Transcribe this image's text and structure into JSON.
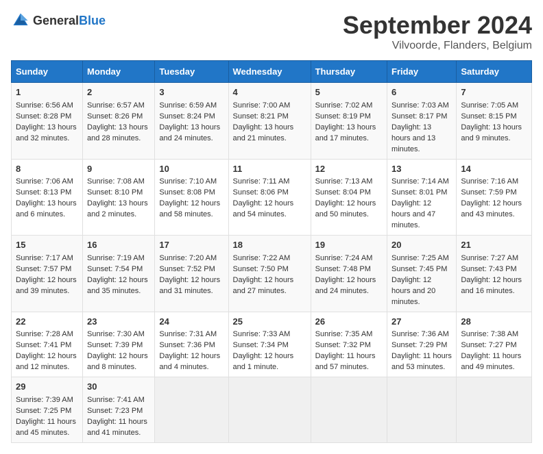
{
  "header": {
    "logo_general": "General",
    "logo_blue": "Blue",
    "title": "September 2024",
    "subtitle": "Vilvoorde, Flanders, Belgium"
  },
  "columns": [
    "Sunday",
    "Monday",
    "Tuesday",
    "Wednesday",
    "Thursday",
    "Friday",
    "Saturday"
  ],
  "weeks": [
    {
      "days": [
        {
          "num": "1",
          "sunrise": "Sunrise: 6:56 AM",
          "sunset": "Sunset: 8:28 PM",
          "daylight": "Daylight: 13 hours and 32 minutes."
        },
        {
          "num": "2",
          "sunrise": "Sunrise: 6:57 AM",
          "sunset": "Sunset: 8:26 PM",
          "daylight": "Daylight: 13 hours and 28 minutes."
        },
        {
          "num": "3",
          "sunrise": "Sunrise: 6:59 AM",
          "sunset": "Sunset: 8:24 PM",
          "daylight": "Daylight: 13 hours and 24 minutes."
        },
        {
          "num": "4",
          "sunrise": "Sunrise: 7:00 AM",
          "sunset": "Sunset: 8:21 PM",
          "daylight": "Daylight: 13 hours and 21 minutes."
        },
        {
          "num": "5",
          "sunrise": "Sunrise: 7:02 AM",
          "sunset": "Sunset: 8:19 PM",
          "daylight": "Daylight: 13 hours and 17 minutes."
        },
        {
          "num": "6",
          "sunrise": "Sunrise: 7:03 AM",
          "sunset": "Sunset: 8:17 PM",
          "daylight": "Daylight: 13 hours and 13 minutes."
        },
        {
          "num": "7",
          "sunrise": "Sunrise: 7:05 AM",
          "sunset": "Sunset: 8:15 PM",
          "daylight": "Daylight: 13 hours and 9 minutes."
        }
      ]
    },
    {
      "days": [
        {
          "num": "8",
          "sunrise": "Sunrise: 7:06 AM",
          "sunset": "Sunset: 8:13 PM",
          "daylight": "Daylight: 13 hours and 6 minutes."
        },
        {
          "num": "9",
          "sunrise": "Sunrise: 7:08 AM",
          "sunset": "Sunset: 8:10 PM",
          "daylight": "Daylight: 13 hours and 2 minutes."
        },
        {
          "num": "10",
          "sunrise": "Sunrise: 7:10 AM",
          "sunset": "Sunset: 8:08 PM",
          "daylight": "Daylight: 12 hours and 58 minutes."
        },
        {
          "num": "11",
          "sunrise": "Sunrise: 7:11 AM",
          "sunset": "Sunset: 8:06 PM",
          "daylight": "Daylight: 12 hours and 54 minutes."
        },
        {
          "num": "12",
          "sunrise": "Sunrise: 7:13 AM",
          "sunset": "Sunset: 8:04 PM",
          "daylight": "Daylight: 12 hours and 50 minutes."
        },
        {
          "num": "13",
          "sunrise": "Sunrise: 7:14 AM",
          "sunset": "Sunset: 8:01 PM",
          "daylight": "Daylight: 12 hours and 47 minutes."
        },
        {
          "num": "14",
          "sunrise": "Sunrise: 7:16 AM",
          "sunset": "Sunset: 7:59 PM",
          "daylight": "Daylight: 12 hours and 43 minutes."
        }
      ]
    },
    {
      "days": [
        {
          "num": "15",
          "sunrise": "Sunrise: 7:17 AM",
          "sunset": "Sunset: 7:57 PM",
          "daylight": "Daylight: 12 hours and 39 minutes."
        },
        {
          "num": "16",
          "sunrise": "Sunrise: 7:19 AM",
          "sunset": "Sunset: 7:54 PM",
          "daylight": "Daylight: 12 hours and 35 minutes."
        },
        {
          "num": "17",
          "sunrise": "Sunrise: 7:20 AM",
          "sunset": "Sunset: 7:52 PM",
          "daylight": "Daylight: 12 hours and 31 minutes."
        },
        {
          "num": "18",
          "sunrise": "Sunrise: 7:22 AM",
          "sunset": "Sunset: 7:50 PM",
          "daylight": "Daylight: 12 hours and 27 minutes."
        },
        {
          "num": "19",
          "sunrise": "Sunrise: 7:24 AM",
          "sunset": "Sunset: 7:48 PM",
          "daylight": "Daylight: 12 hours and 24 minutes."
        },
        {
          "num": "20",
          "sunrise": "Sunrise: 7:25 AM",
          "sunset": "Sunset: 7:45 PM",
          "daylight": "Daylight: 12 hours and 20 minutes."
        },
        {
          "num": "21",
          "sunrise": "Sunrise: 7:27 AM",
          "sunset": "Sunset: 7:43 PM",
          "daylight": "Daylight: 12 hours and 16 minutes."
        }
      ]
    },
    {
      "days": [
        {
          "num": "22",
          "sunrise": "Sunrise: 7:28 AM",
          "sunset": "Sunset: 7:41 PM",
          "daylight": "Daylight: 12 hours and 12 minutes."
        },
        {
          "num": "23",
          "sunrise": "Sunrise: 7:30 AM",
          "sunset": "Sunset: 7:39 PM",
          "daylight": "Daylight: 12 hours and 8 minutes."
        },
        {
          "num": "24",
          "sunrise": "Sunrise: 7:31 AM",
          "sunset": "Sunset: 7:36 PM",
          "daylight": "Daylight: 12 hours and 4 minutes."
        },
        {
          "num": "25",
          "sunrise": "Sunrise: 7:33 AM",
          "sunset": "Sunset: 7:34 PM",
          "daylight": "Daylight: 12 hours and 1 minute."
        },
        {
          "num": "26",
          "sunrise": "Sunrise: 7:35 AM",
          "sunset": "Sunset: 7:32 PM",
          "daylight": "Daylight: 11 hours and 57 minutes."
        },
        {
          "num": "27",
          "sunrise": "Sunrise: 7:36 AM",
          "sunset": "Sunset: 7:29 PM",
          "daylight": "Daylight: 11 hours and 53 minutes."
        },
        {
          "num": "28",
          "sunrise": "Sunrise: 7:38 AM",
          "sunset": "Sunset: 7:27 PM",
          "daylight": "Daylight: 11 hours and 49 minutes."
        }
      ]
    },
    {
      "days": [
        {
          "num": "29",
          "sunrise": "Sunrise: 7:39 AM",
          "sunset": "Sunset: 7:25 PM",
          "daylight": "Daylight: 11 hours and 45 minutes."
        },
        {
          "num": "30",
          "sunrise": "Sunrise: 7:41 AM",
          "sunset": "Sunset: 7:23 PM",
          "daylight": "Daylight: 11 hours and 41 minutes."
        },
        {
          "num": "",
          "sunrise": "",
          "sunset": "",
          "daylight": ""
        },
        {
          "num": "",
          "sunrise": "",
          "sunset": "",
          "daylight": ""
        },
        {
          "num": "",
          "sunrise": "",
          "sunset": "",
          "daylight": ""
        },
        {
          "num": "",
          "sunrise": "",
          "sunset": "",
          "daylight": ""
        },
        {
          "num": "",
          "sunrise": "",
          "sunset": "",
          "daylight": ""
        }
      ]
    }
  ]
}
